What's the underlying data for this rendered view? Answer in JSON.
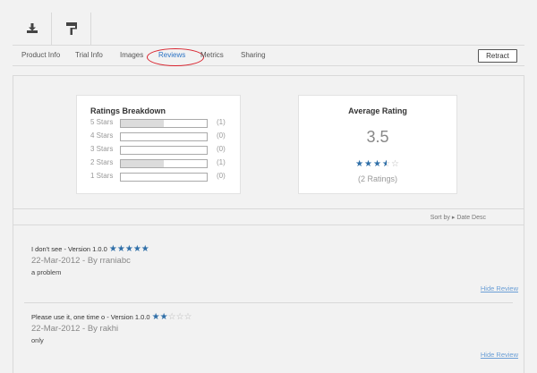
{
  "toolbar": {
    "items": [
      {
        "icon": "download-icon"
      },
      {
        "icon": "paint-roller-icon"
      }
    ]
  },
  "tabs": [
    {
      "label": "Product Info",
      "active": false
    },
    {
      "label": "Trial Info",
      "active": false
    },
    {
      "label": "Images",
      "active": false
    },
    {
      "label": "Reviews",
      "active": true
    },
    {
      "label": "Metrics",
      "active": false
    },
    {
      "label": "Sharing",
      "active": false
    }
  ],
  "retract_label": "Retract",
  "ratings_breakdown": {
    "title": "Ratings Breakdown",
    "rows": [
      {
        "label": "5 Stars",
        "count": "(1)",
        "fraction": 0.5
      },
      {
        "label": "4 Stars",
        "count": "(0)",
        "fraction": 0
      },
      {
        "label": "3 Stars",
        "count": "(0)",
        "fraction": 0
      },
      {
        "label": "2 Stars",
        "count": "(1)",
        "fraction": 0.5
      },
      {
        "label": "1 Stars",
        "count": "(0)",
        "fraction": 0
      }
    ]
  },
  "average_rating": {
    "title": "Average Rating",
    "value": "3.5",
    "stars": 3.5,
    "count_text": "(2 Ratings)"
  },
  "sort": {
    "prefix": "Sort by",
    "arrow": "▸",
    "value": "Date Desc"
  },
  "reviews": [
    {
      "title": "I don't see - Version 1.0.0",
      "rating": 5,
      "meta": "22-Mar-2012 - By rraniabc",
      "body": "a problem",
      "hide_label": "Hide Review"
    },
    {
      "title": "Please use it, one time o - Version 1.0.0",
      "rating": 2,
      "meta": "22-Mar-2012 - By rakhi",
      "body": "only",
      "hide_label": "Hide Review"
    }
  ],
  "colors": {
    "accent": "#2a72c4",
    "highlight": "#d9232e",
    "star": "#2f6fa8"
  }
}
